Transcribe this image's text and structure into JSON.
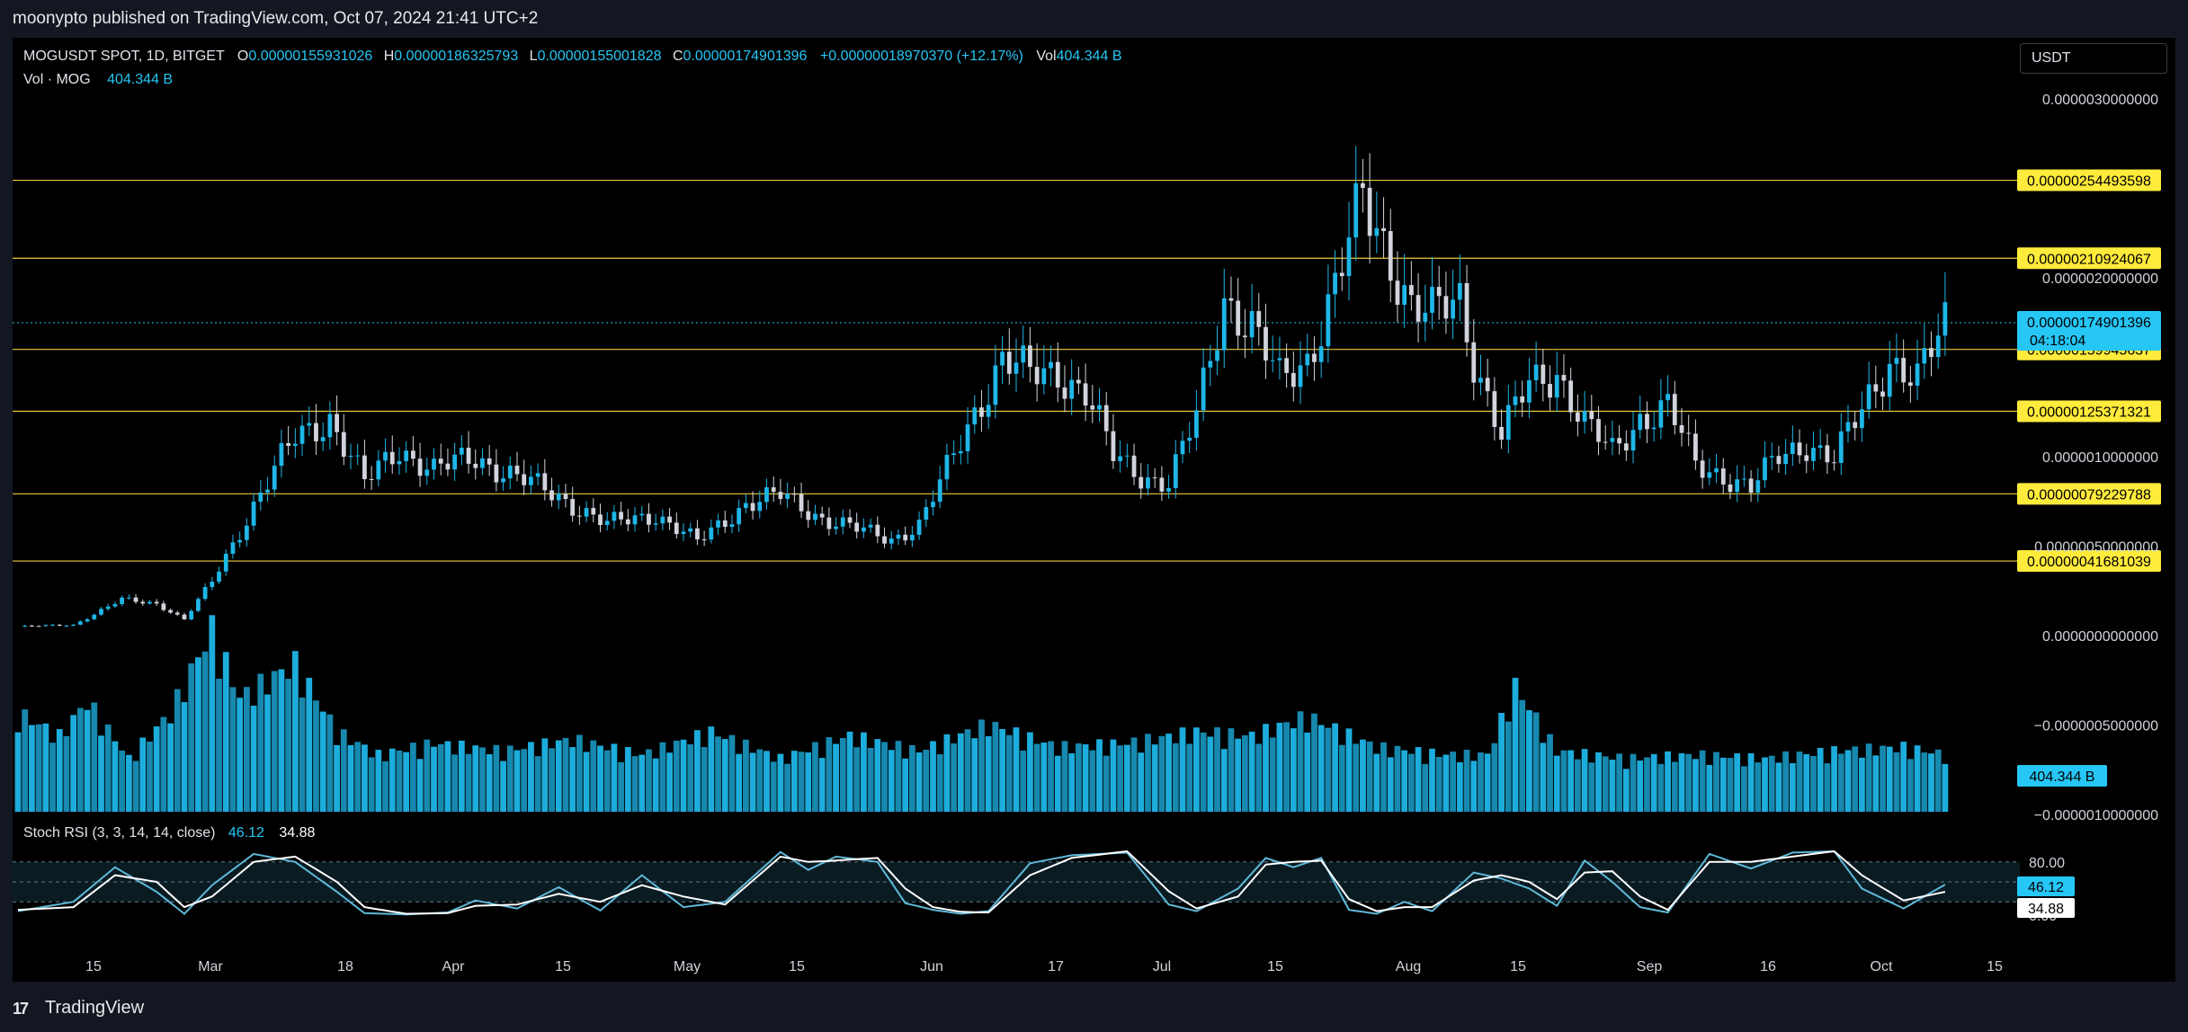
{
  "publisher_line": "moonypto published on TradingView.com, Oct 07, 2024 21:41 UTC+2",
  "header": {
    "symbol": "MOGUSDT SPOT, 1D, BITGET",
    "open_label": "O",
    "open": "0.00000155931026",
    "high_label": "H",
    "high": "0.00000186325793",
    "low_label": "L",
    "low": "0.00000155001828",
    "close_label": "C",
    "close": "0.00000174901396",
    "change": "+0.00000018970370 (+12.17%)",
    "vol_label": "Vol",
    "vol": "404.344 B"
  },
  "volume_legend": {
    "name": "Vol · MOG",
    "value": "404.344 B"
  },
  "currency_button": "USDT",
  "stoch_legend": {
    "name": "Stoch RSI (3, 3, 14, 14, close)",
    "k": "46.12",
    "d": "34.88"
  },
  "footer": {
    "logo_mark": "17",
    "brand": "TradingView"
  },
  "colors": {
    "up": "#1fb6e8",
    "down": "#d1d4dc",
    "level_line": "#e8c93c",
    "level_label_bg": "#ffeb3b",
    "price_label_bg": "#26c6f5",
    "volume": "#1fb6e8",
    "stoch_k": "#5fb8d8",
    "stoch_d": "#ffffff"
  },
  "chart_data": {
    "type": "candlestick",
    "price_axis": {
      "ticks": [
        {
          "v": 3e-06,
          "label": "0.0000030000000"
        },
        {
          "v": 2e-06,
          "label": "0.0000020000000"
        },
        {
          "v": 1e-06,
          "label": "0.0000010000000"
        },
        {
          "v": 5e-07,
          "label": "0.00000050000000"
        },
        {
          "v": 0,
          "label": "0.0000000000000"
        },
        {
          "v": -5e-07,
          "label": "−0.0000005000000"
        },
        {
          "v": -1e-06,
          "label": "−0.0000010000000"
        }
      ]
    },
    "levels": [
      {
        "v": 2.54493598e-06,
        "label": "0.00000254493598"
      },
      {
        "v": 2.10924067e-06,
        "label": "0.00000210924067"
      },
      {
        "v": 1.59945637e-06,
        "label": "0.00000159945637"
      },
      {
        "v": 1.25371321e-06,
        "label": "0.00000125371321"
      },
      {
        "v": 7.9229788e-07,
        "label": "0.00000079229788"
      },
      {
        "v": 4.1681039e-07,
        "label": "0.00000041681039"
      }
    ],
    "last_price": {
      "v": 1.74901396e-06,
      "label": "0.00000174901396",
      "countdown": "04:18:04"
    },
    "volume_label": "404.344 B",
    "stoch_axis": [
      {
        "v": 80,
        "label": "80.00"
      },
      {
        "v": 0,
        "label": "0.00"
      }
    ],
    "stoch_last": {
      "k": "46.12",
      "d": "34.88"
    },
    "time_axis": [
      "15",
      "Mar",
      "18",
      "Apr",
      "15",
      "May",
      "15",
      "Jun",
      "17",
      "Jul",
      "15",
      "Aug",
      "15",
      "Sep",
      "16",
      "Oct",
      "15"
    ],
    "close_path": [
      [
        0,
        0.05
      ],
      [
        8,
        0.06
      ],
      [
        15,
        0.2
      ],
      [
        20,
        0.18
      ],
      [
        24,
        0.09
      ],
      [
        28,
        0.3
      ],
      [
        35,
        0.8
      ],
      [
        40,
        1.1
      ],
      [
        45,
        1.22
      ],
      [
        50,
        0.85
      ],
      [
        55,
        1.05
      ],
      [
        60,
        0.92
      ],
      [
        66,
        1.0
      ],
      [
        72,
        0.88
      ],
      [
        78,
        0.78
      ],
      [
        85,
        0.62
      ],
      [
        92,
        0.68
      ],
      [
        98,
        0.52
      ],
      [
        105,
        0.74
      ],
      [
        110,
        0.78
      ],
      [
        116,
        0.66
      ],
      [
        122,
        0.58
      ],
      [
        126,
        0.54
      ],
      [
        130,
        0.62
      ],
      [
        134,
        0.92
      ],
      [
        138,
        1.25
      ],
      [
        142,
        1.55
      ],
      [
        146,
        1.45
      ],
      [
        150,
        1.48
      ],
      [
        154,
        1.36
      ],
      [
        158,
        1.0
      ],
      [
        162,
        0.9
      ],
      [
        166,
        0.85
      ],
      [
        170,
        1.22
      ],
      [
        174,
        1.9
      ],
      [
        178,
        1.72
      ],
      [
        182,
        1.42
      ],
      [
        186,
        1.55
      ],
      [
        190,
        1.95
      ],
      [
        194,
        2.42
      ],
      [
        198,
        2.12
      ],
      [
        201,
        1.85
      ],
      [
        204,
        1.78
      ],
      [
        208,
        1.88
      ],
      [
        210,
        1.56
      ],
      [
        214,
        1.12
      ],
      [
        218,
        1.4
      ],
      [
        222,
        1.48
      ],
      [
        226,
        1.18
      ],
      [
        230,
        1.02
      ],
      [
        234,
        1.22
      ],
      [
        238,
        1.28
      ],
      [
        242,
        0.95
      ],
      [
        246,
        0.9
      ],
      [
        250,
        0.82
      ],
      [
        254,
        1.0
      ],
      [
        258,
        1.08
      ],
      [
        262,
        0.98
      ],
      [
        266,
        1.26
      ],
      [
        270,
        1.55
      ],
      [
        274,
        1.42
      ],
      [
        276,
        1.58
      ],
      [
        278,
        1.74
      ]
    ],
    "highs": [],
    "volume_path": [
      [
        0,
        52
      ],
      [
        6,
        40
      ],
      [
        10,
        58
      ],
      [
        16,
        28
      ],
      [
        22,
        52
      ],
      [
        28,
        96
      ],
      [
        32,
        60
      ],
      [
        40,
        78
      ],
      [
        46,
        42
      ],
      [
        52,
        30
      ],
      [
        60,
        36
      ],
      [
        70,
        32
      ],
      [
        80,
        38
      ],
      [
        90,
        30
      ],
      [
        100,
        42
      ],
      [
        110,
        28
      ],
      [
        120,
        40
      ],
      [
        130,
        32
      ],
      [
        140,
        46
      ],
      [
        150,
        34
      ],
      [
        160,
        36
      ],
      [
        170,
        42
      ],
      [
        178,
        40
      ],
      [
        186,
        50
      ],
      [
        196,
        34
      ],
      [
        206,
        30
      ],
      [
        212,
        30
      ],
      [
        216,
        66
      ],
      [
        222,
        32
      ],
      [
        232,
        28
      ],
      [
        242,
        30
      ],
      [
        252,
        28
      ],
      [
        262,
        32
      ],
      [
        272,
        34
      ],
      [
        278,
        30
      ]
    ],
    "stoch_k": [
      [
        0,
        6
      ],
      [
        8,
        20
      ],
      [
        14,
        72
      ],
      [
        20,
        35
      ],
      [
        24,
        2
      ],
      [
        28,
        45
      ],
      [
        34,
        92
      ],
      [
        40,
        80
      ],
      [
        46,
        35
      ],
      [
        50,
        3
      ],
      [
        56,
        1
      ],
      [
        62,
        4
      ],
      [
        66,
        22
      ],
      [
        72,
        10
      ],
      [
        78,
        42
      ],
      [
        84,
        7
      ],
      [
        90,
        60
      ],
      [
        96,
        12
      ],
      [
        102,
        20
      ],
      [
        110,
        95
      ],
      [
        114,
        68
      ],
      [
        118,
        88
      ],
      [
        124,
        80
      ],
      [
        128,
        18
      ],
      [
        132,
        8
      ],
      [
        136,
        2
      ],
      [
        140,
        6
      ],
      [
        146,
        78
      ],
      [
        152,
        90
      ],
      [
        160,
        94
      ],
      [
        166,
        16
      ],
      [
        170,
        6
      ],
      [
        176,
        40
      ],
      [
        180,
        86
      ],
      [
        184,
        72
      ],
      [
        188,
        86
      ],
      [
        192,
        8
      ],
      [
        196,
        2
      ],
      [
        200,
        20
      ],
      [
        204,
        6
      ],
      [
        210,
        64
      ],
      [
        214,
        55
      ],
      [
        218,
        40
      ],
      [
        222,
        14
      ],
      [
        226,
        82
      ],
      [
        230,
        50
      ],
      [
        234,
        12
      ],
      [
        238,
        4
      ],
      [
        244,
        92
      ],
      [
        250,
        70
      ],
      [
        256,
        94
      ],
      [
        262,
        96
      ],
      [
        266,
        40
      ],
      [
        272,
        10
      ],
      [
        278,
        46
      ]
    ],
    "stoch_d": [
      [
        0,
        8
      ],
      [
        8,
        12
      ],
      [
        14,
        60
      ],
      [
        20,
        50
      ],
      [
        24,
        12
      ],
      [
        28,
        28
      ],
      [
        34,
        80
      ],
      [
        40,
        88
      ],
      [
        46,
        50
      ],
      [
        50,
        12
      ],
      [
        56,
        2
      ],
      [
        62,
        3
      ],
      [
        66,
        14
      ],
      [
        72,
        16
      ],
      [
        78,
        32
      ],
      [
        84,
        20
      ],
      [
        90,
        45
      ],
      [
        96,
        28
      ],
      [
        102,
        16
      ],
      [
        110,
        88
      ],
      [
        114,
        80
      ],
      [
        118,
        82
      ],
      [
        124,
        86
      ],
      [
        128,
        40
      ],
      [
        132,
        12
      ],
      [
        136,
        5
      ],
      [
        140,
        4
      ],
      [
        146,
        60
      ],
      [
        152,
        86
      ],
      [
        160,
        96
      ],
      [
        166,
        36
      ],
      [
        170,
        10
      ],
      [
        176,
        28
      ],
      [
        180,
        76
      ],
      [
        184,
        80
      ],
      [
        188,
        82
      ],
      [
        192,
        24
      ],
      [
        196,
        6
      ],
      [
        200,
        12
      ],
      [
        204,
        12
      ],
      [
        210,
        52
      ],
      [
        214,
        60
      ],
      [
        218,
        50
      ],
      [
        222,
        24
      ],
      [
        226,
        64
      ],
      [
        230,
        66
      ],
      [
        234,
        28
      ],
      [
        238,
        8
      ],
      [
        244,
        80
      ],
      [
        250,
        80
      ],
      [
        256,
        88
      ],
      [
        262,
        96
      ],
      [
        266,
        60
      ],
      [
        272,
        22
      ],
      [
        278,
        35
      ]
    ]
  }
}
